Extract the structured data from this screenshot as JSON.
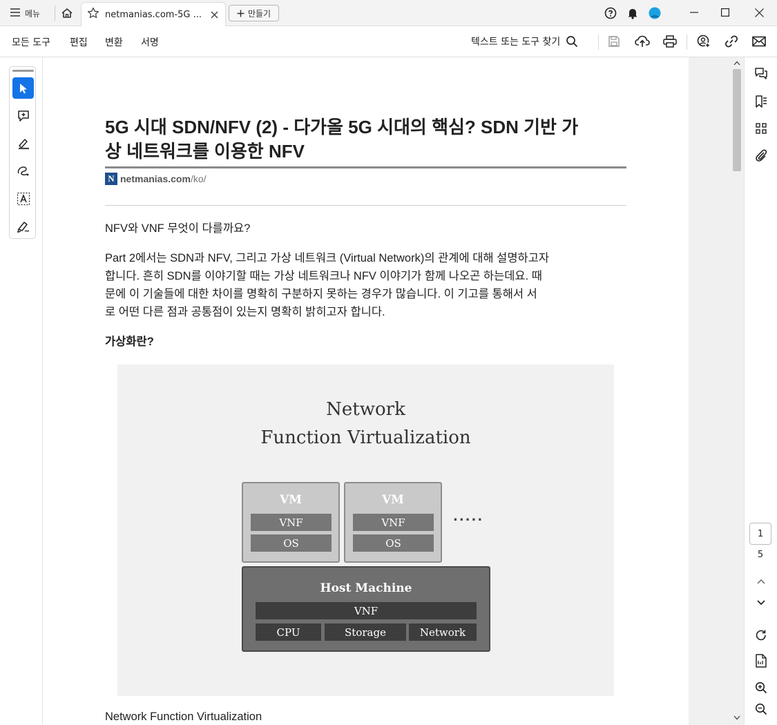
{
  "titlebar": {
    "menu_label": "메뉴",
    "tab_title": "netmanias.com-5G ...",
    "new_button_label": "만들기",
    "avatar_color": "#1ba1e2"
  },
  "toolbar": {
    "menu": [
      "모든 도구",
      "편집",
      "변환",
      "서명"
    ],
    "find_label": "텍스트 또는 도구 찾기"
  },
  "navigation": {
    "current_page": "1",
    "total_pages": "5"
  },
  "document": {
    "title_line1": "5G 시대 SDN/NFV (2) - 다가올 5G 시대의 핵심? SDN 기반 가",
    "title_line2": "상 네트워크를 이용한 NFV",
    "brand_logo_letter": "N",
    "brand_domain": "netmanias.com",
    "brand_path": "/ko/",
    "question": "NFV와 VNF 무엇이 다를까요?",
    "paragraph_lines": [
      "Part 2에서는 SDN과 NFV, 그리고 가상 네트워크 (Virtual Network)의 관계에 대해 설명하고자",
      "합니다. 흔히 SDN를 이야기할 때는 가상 네트워크나 NFV 이야기가 함께 나오곤 하는데요. 때",
      "문에 이 기술들에 대한 차이를 명확히 구분하지 못하는 경우가 많습니다. 이 기고를 통해서 서",
      "로 어떤 다른 점과 공통점이 있는지 명확히 밝히고자 합니다."
    ],
    "section_heading": "가상화란?",
    "figure": {
      "title_line1": "Network",
      "title_line2": "Function Virtualization",
      "vm_label": "VM",
      "vnf_label": "VNF",
      "os_label": "OS",
      "ellipsis": ".....",
      "host_label": "Host Machine",
      "host_vnf": "VNF",
      "host_cells": [
        "CPU",
        "Storage",
        "Network"
      ]
    },
    "caption": "Network Function Virtualization"
  },
  "colors": {
    "accent": "#1473e6",
    "title_rule": "#8a8a8a"
  }
}
